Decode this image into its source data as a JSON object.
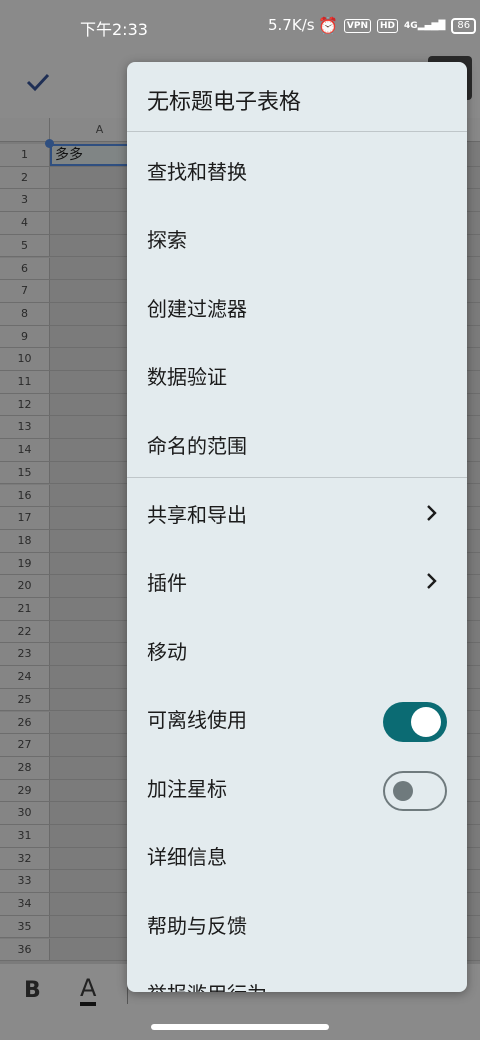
{
  "status_bar": {
    "time": "下午2:33",
    "net_speed": "5.7K/s",
    "vpn": "VPN",
    "hd": "HD",
    "signal": "4G",
    "battery": "86"
  },
  "sheet": {
    "column_a": "A",
    "cell_a1": "多多",
    "row_numbers": [
      "1",
      "2",
      "3",
      "4",
      "5",
      "6",
      "7",
      "8",
      "9",
      "10",
      "11",
      "12",
      "13",
      "14",
      "15",
      "16",
      "17",
      "18",
      "19",
      "20",
      "21",
      "22",
      "23",
      "24",
      "25",
      "26",
      "27",
      "28",
      "29",
      "30",
      "31",
      "32",
      "33",
      "34",
      "35",
      "36"
    ]
  },
  "bottom_toolbar": {
    "bold": "B",
    "text_color": "A"
  },
  "menu": {
    "title": "无标题电子表格",
    "items": [
      {
        "label": "查找和替换"
      },
      {
        "label": "探索"
      },
      {
        "label": "创建过滤器"
      },
      {
        "label": "数据验证"
      },
      {
        "label": "命名的范围"
      },
      {
        "label": "共享和导出",
        "submenu": true
      },
      {
        "label": "插件",
        "submenu": true
      },
      {
        "label": "移动"
      },
      {
        "label": "可离线使用",
        "toggle": true,
        "checked": true
      },
      {
        "label": "加注星标",
        "toggle": true,
        "checked": false
      },
      {
        "label": "详细信息"
      },
      {
        "label": "帮助与反馈"
      },
      {
        "label": "举报滥用行为"
      }
    ]
  },
  "colors": {
    "accent": "#0b6b73",
    "menu_bg": "#e3ebee",
    "selection": "#2f4f80"
  }
}
